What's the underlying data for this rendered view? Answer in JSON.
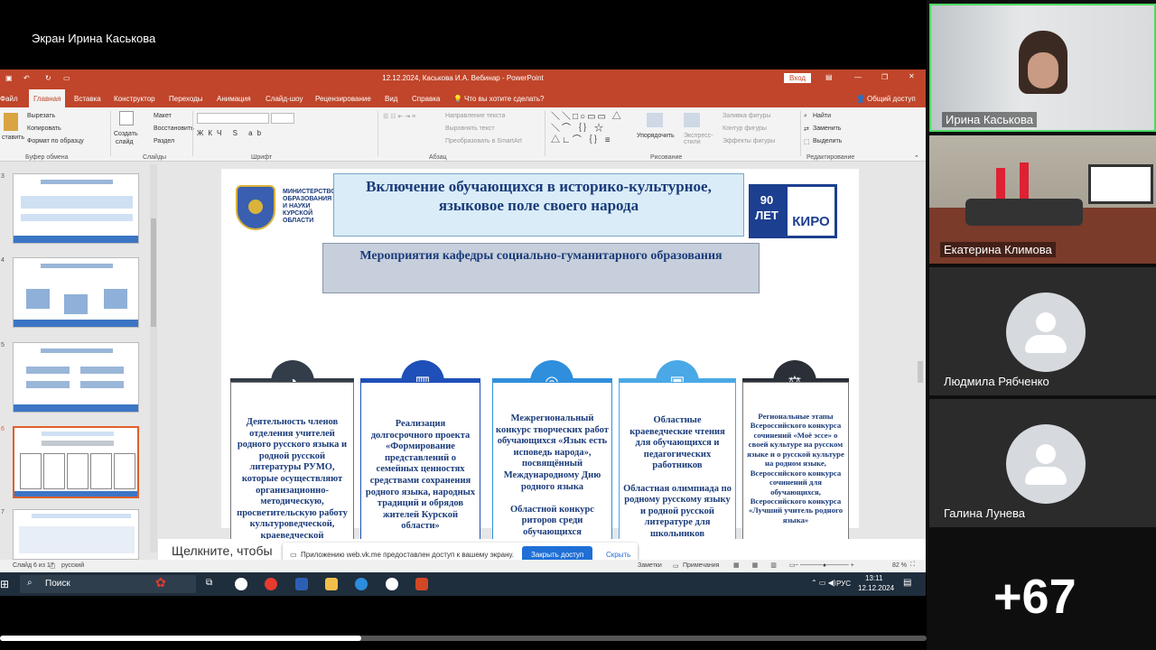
{
  "screen_share": {
    "title": "Экран Ирина Каськова"
  },
  "ppt": {
    "window_title": "12.12.2024, Каськова И.А. Вебинар  -  PowerPoint",
    "login_button": "Вход",
    "tabs": [
      "Файл",
      "Главная",
      "Вставка",
      "Конструктор",
      "Переходы",
      "Анимация",
      "Слайд-шоу",
      "Рецензирование",
      "Вид",
      "Справка"
    ],
    "tell_me": "Что вы хотите сделать?",
    "share": "Общий доступ",
    "ribbon": {
      "clipboard": {
        "paste": "ставить",
        "cut": "Вырезать",
        "copy": "Копировать",
        "format": "Формат по образцу",
        "label": "Буфер обмена"
      },
      "slides": {
        "new": "Создать",
        "new2": "слайд",
        "layout": "Макет",
        "reset": "Восстановить",
        "section": "Раздел",
        "label": "Слайды"
      },
      "font": {
        "label": "Шрифт"
      },
      "paragraph": {
        "dir": "Направление текста",
        "align": "Выровнять текст",
        "smartart": "Преобразовать в SmartArt",
        "label": "Абзац"
      },
      "drawing": {
        "arrange": "Упорядочить",
        "styles": "Экспресс-стили",
        "fill": "Заливка фигуры",
        "outline": "Контур фигуры",
        "effects": "Эффекты фигуры",
        "label": "Рисование"
      },
      "editing": {
        "find": "Найти",
        "replace": "Заменить",
        "select": "Выделить",
        "label": "Редактирование"
      }
    },
    "thumb_numbers": [
      "3",
      "4",
      "5",
      "6",
      "7"
    ],
    "slide": {
      "ministry": "МИНИСТЕРСТВО ОБРАЗОВАНИЯ И НАУКИ КУРСКОЙ ОБЛАСТИ",
      "title": "Включение обучающихся в историко-культурное, языковое поле своего народа",
      "logo_years": "90 ЛЕТ",
      "logo_kiro": "КИРО",
      "subtitle": "Мероприятия кафедры социально-гуманитарного образования",
      "columns": [
        {
          "text": "Деятельность членов отделения учителей родного русского языка и родной русской литературы РУМО, которые осуществляют организационно-методическую, просветительскую работу культуроведческой, краеведческой направленности в регионе",
          "color": "#333d4a"
        },
        {
          "text": "Реализация долгосрочного проекта «Формирование представлений о семейных ценностях средствами сохранения родного языка, народных традиций и обрядов жителей Курской области»",
          "color": "#1f4fb8"
        },
        {
          "text": "Межрегиональный конкурс творческих работ обучающихся «Язык есть исповедь народа», посвящённый Международному Дню родного языка\n\nОбластной конкурс риторов среди обучающихся",
          "color": "#2f8fdc"
        },
        {
          "text": "Областные краеведческие чтения для обучающихся и педагогических работников\n\nОбластная олимпиада по родному русскому языку и родной русской литературе для школьников",
          "color": "#4aa8e6"
        },
        {
          "text": "Региональные этапы Всероссийского конкурса сочинений «Моё эссе» о своей культуре на русском языке и о русской культуре на родном языке, Всероссийского конкурса сочинений для обучающихся, Всероссийского конкурса «Лучший учитель родного языка»",
          "color": "#2a2f38"
        }
      ]
    },
    "notes_placeholder": "Щелкните, чтобы",
    "status": {
      "slide": "Слайд 6 из 17",
      "lang": "русский",
      "notes": "Заметки",
      "comments": "Примечания",
      "zoom": "82 %"
    },
    "banner": {
      "text": "Приложению web.vk.me предоставлен доступ к вашему экрану.",
      "close": "Закрыть доступ",
      "hide": "Скрыть"
    },
    "taskbar": {
      "search": "Поиск",
      "lang": "РУС",
      "time": "13:11",
      "date": "12.12.2024"
    }
  },
  "participants": [
    {
      "name": "Ирина Каськова",
      "type": "video"
    },
    {
      "name": "Екатерина Климова",
      "type": "video"
    },
    {
      "name": "Людмила Рябченко",
      "type": "avatar"
    },
    {
      "name": "Галина Лунева",
      "type": "avatar"
    }
  ],
  "more_participants": "+67",
  "video_progress": 0.39
}
